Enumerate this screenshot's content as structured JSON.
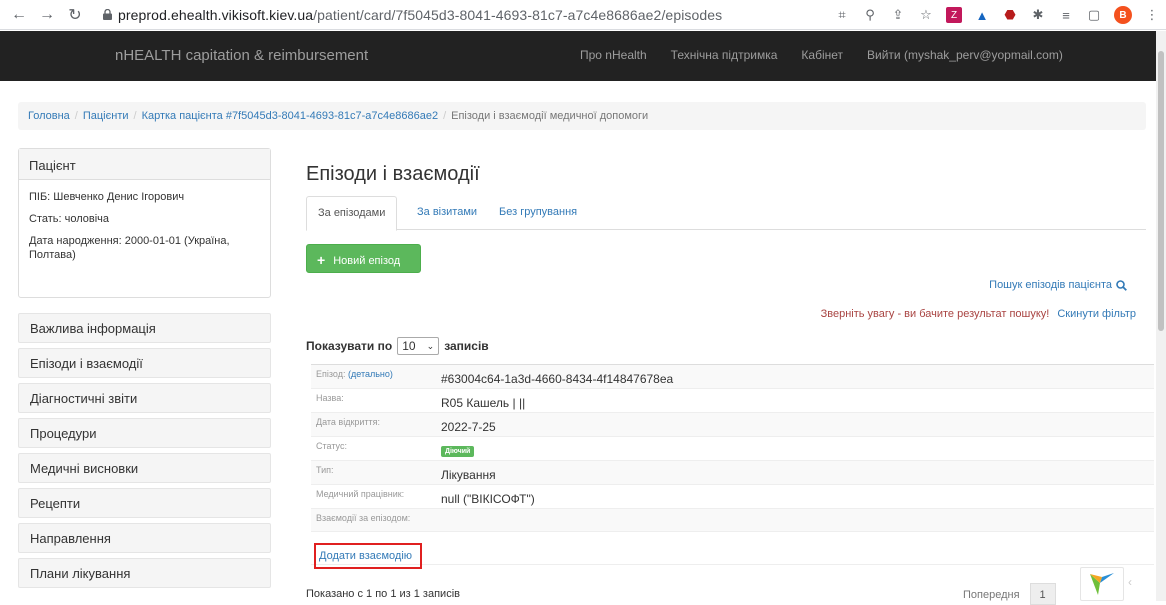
{
  "browser": {
    "url_host": "preprod.ehealth.vikisoft.kiev.ua",
    "url_path": "/patient/card/7f5045d3-8041-4693-81c7-a7c4e8686ae2/episodes",
    "avatar_letter": "B"
  },
  "navbar": {
    "brand": "nHEALTH capitation & reimbursement",
    "links": [
      "Про nHealth",
      "Технічна підтримка",
      "Кабінет",
      "Вийти (myshak_perv@yopmail.com)"
    ]
  },
  "breadcrumb": {
    "home": "Головна",
    "patients": "Пацієнти",
    "card": "Картка пацієнта #7f5045d3-8041-4693-81c7-a7c4e8686ae2",
    "current": "Епізоди і взаємодії медичної допомоги"
  },
  "patient_panel": {
    "heading": "Пацієнт",
    "name": "ПІБ: Шевченко Денис Ігорович",
    "sex": "Стать: чоловіча",
    "birth": "Дата народження: 2000-01-01 (Україна, Полтава)"
  },
  "side_menu": [
    "Важлива інформація",
    "Епізоди і взаємодії",
    "Діагностичні звіти",
    "Процедури",
    "Медичні висновки",
    "Рецепти",
    "Направлення",
    "Плани лікування"
  ],
  "main": {
    "title": "Епізоди і взаємодії",
    "tabs": [
      "За епізодами",
      "За візитами",
      "Без групування"
    ],
    "new_episode": "Новий епізод",
    "search_link": "Пошук епізодів пацієнта",
    "notice": "Зверніть увагу - ви бачите результат пошуку!",
    "reset_filter": "Скинути фільтр",
    "show_prefix": "Показувати по",
    "show_value": "10",
    "show_suffix": "записів"
  },
  "episode": {
    "label_episode": "Епізод:",
    "label_detail": "(детально)",
    "id": "#63004c64-1a3d-4660-8434-4f14847678ea",
    "label_name": "Назва:",
    "name": "R05 Кашель | ||",
    "label_opened": "Дата відкриття:",
    "opened": "2022-7-25",
    "label_status": "Статус:",
    "status": "Діючий",
    "label_type": "Тип:",
    "type": "Лікування",
    "label_worker": "Медичний працівник:",
    "worker": "null (\"ВІКІСОФТ\")",
    "label_interactions": "Взаємодії за епізодом:",
    "add_interaction": "Додати взаємодію"
  },
  "footer": {
    "info": "Показано с 1 по 1 из 1 записів",
    "prev": "Попередня",
    "page": "1"
  },
  "colors": {
    "navbar": "#222222",
    "link": "#337ab7",
    "success": "#5cb85c",
    "warning": "#a94442",
    "highlight": "#e02020"
  }
}
